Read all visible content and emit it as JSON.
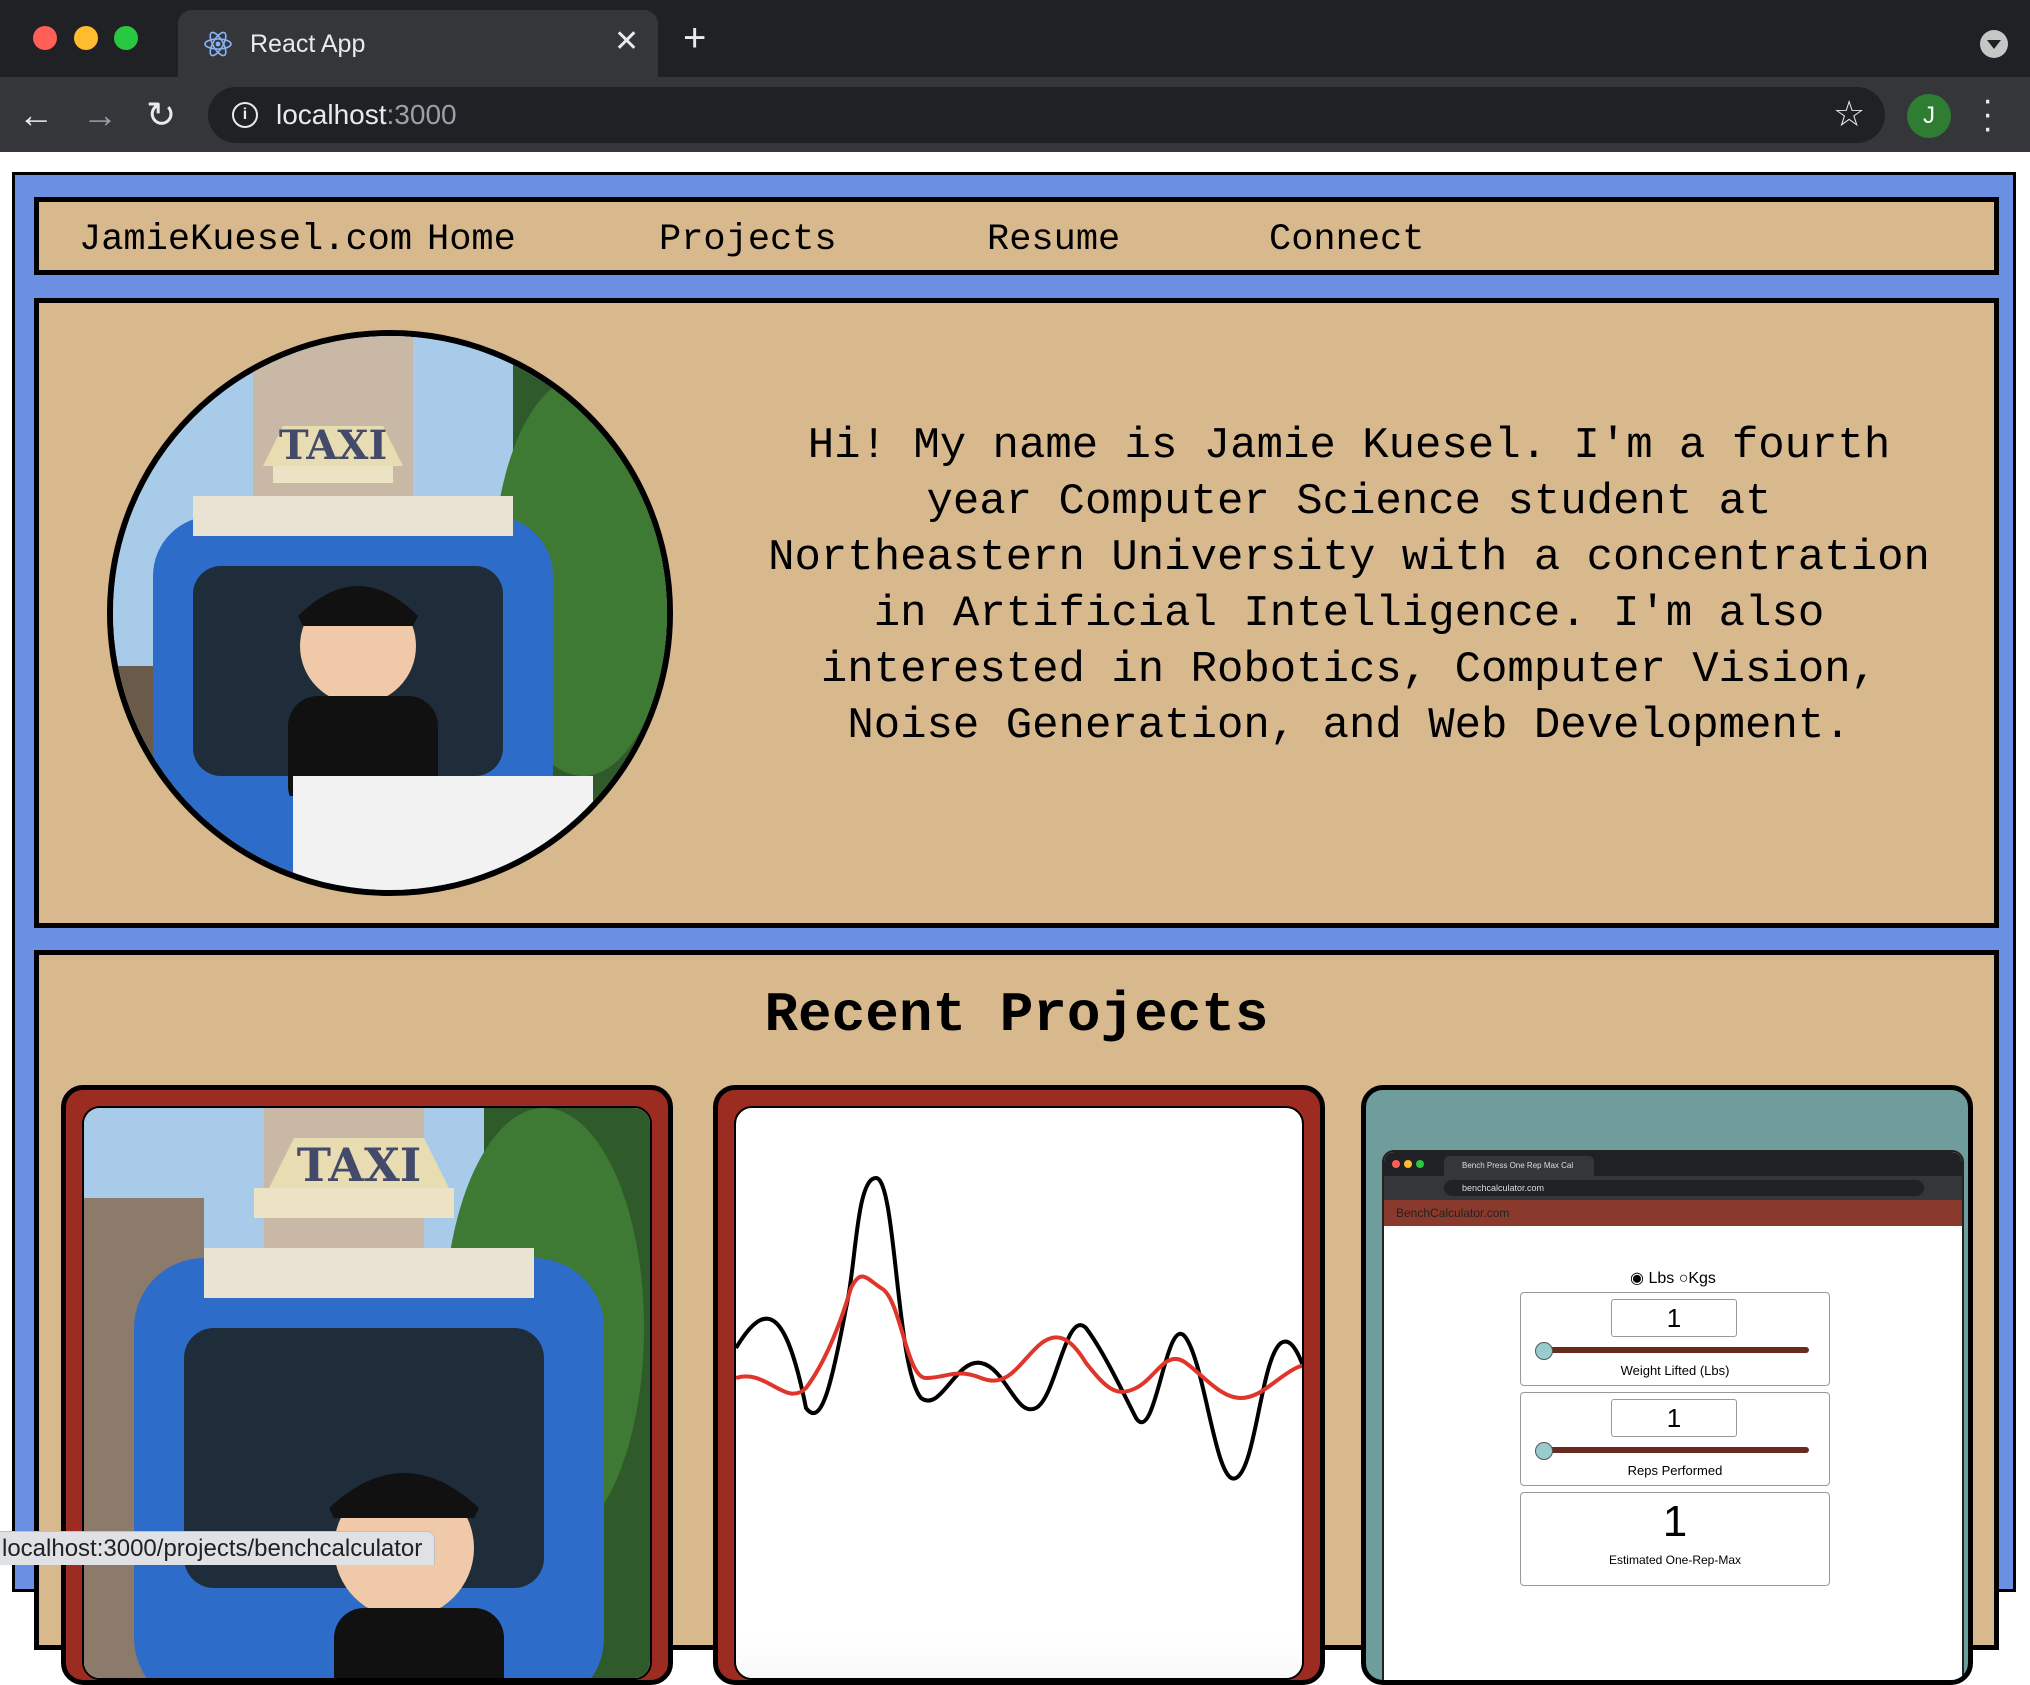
{
  "browser": {
    "tab_title": "React App",
    "url_host": "localhost",
    "url_port": ":3000",
    "profile_initial": "J",
    "status_url": "localhost:3000/projects/benchcalculator"
  },
  "nav": {
    "brand": "JamieKuesel.com",
    "home": "Home",
    "projects": "Projects",
    "resume": "Resume",
    "connect": "Connect"
  },
  "hero": {
    "intro": "Hi! My name is Jamie Kuesel. I'm a fourth year Computer Science student at Northeastern University with a concentration in Artificial Intelligence. I'm also interested in Robotics, Computer Vision, Noise Generation, and Web Development.",
    "photo_sign": "TAXI"
  },
  "projects": {
    "title": "Recent Projects"
  },
  "bench_preview": {
    "tab": "Bench Press One Rep Max Cal",
    "url": "benchcalculator.com",
    "header": "BenchCalculator.com",
    "unit_lbs": "Lbs",
    "unit_kgs": "Kgs",
    "weight_value": "1",
    "weight_label": "Weight Lifted (Lbs)",
    "reps_value": "1",
    "reps_label": "Reps Performed",
    "orm_value": "1",
    "orm_label": "Estimated One-Rep-Max"
  },
  "colors": {
    "page_blue": "#6b8fe2",
    "panel_tan": "#d8b98e",
    "card_red": "#9c2b22",
    "card_teal": "#6e9d9c"
  }
}
